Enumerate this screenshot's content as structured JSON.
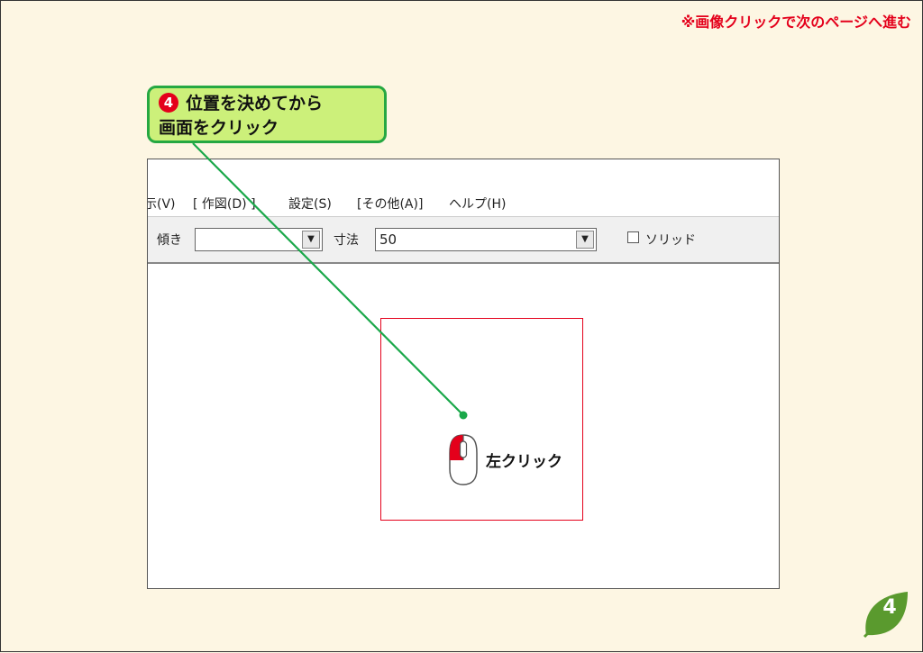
{
  "notice": "※画像クリックで次のページへ進む",
  "callout": {
    "number": "4",
    "line1": "位置を決めてから",
    "line2": "画面をクリック"
  },
  "menu": [
    {
      "label": "示(V)"
    },
    {
      "label": "[ 作図(D) ]"
    },
    {
      "label": "設定(S)"
    },
    {
      "label": "[その他(A)]"
    },
    {
      "label": "ヘルプ(H)"
    }
  ],
  "toolbar": {
    "tilt_label": "傾き",
    "tilt_value": "",
    "size_label": "寸法",
    "size_value": "50",
    "solid_label": "ソリッド",
    "solid_checked": false
  },
  "left_click_label": "左クリック",
  "page_number": "4",
  "colors": {
    "accent_red": "#e4001b",
    "callout_fill": "#ccf07a",
    "callout_border": "#25a842",
    "leader_line": "#1aa84a",
    "page_badge": "#5a9a2e"
  }
}
